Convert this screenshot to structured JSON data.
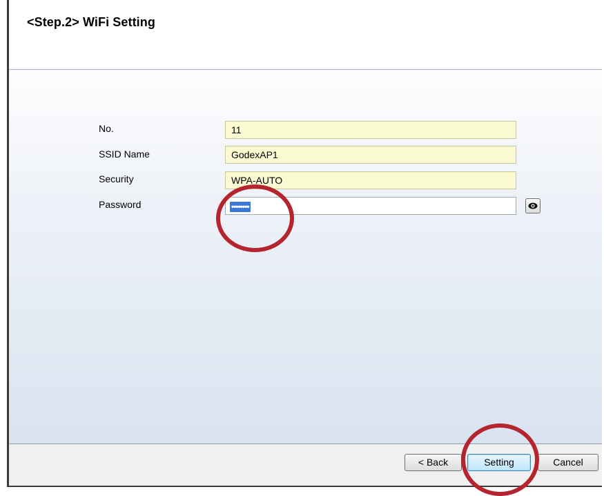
{
  "header": {
    "title": "<Step.2> WiFi Setting"
  },
  "form": {
    "no_label": "No.",
    "no_value": "11",
    "ssid_label": "SSID Name",
    "ssid_value": "GodexAP1",
    "security_label": "Security",
    "security_value": "WPA-AUTO",
    "password_label": "Password",
    "password_value": "••••••••"
  },
  "buttons": {
    "back": "< Back",
    "setting": "Setting",
    "cancel": "Cancel"
  },
  "icons": {
    "show_password": "eye-icon"
  },
  "colors": {
    "field_bg": "#fafad2",
    "selection": "#3b78d8",
    "annotation": "#b5252f"
  }
}
